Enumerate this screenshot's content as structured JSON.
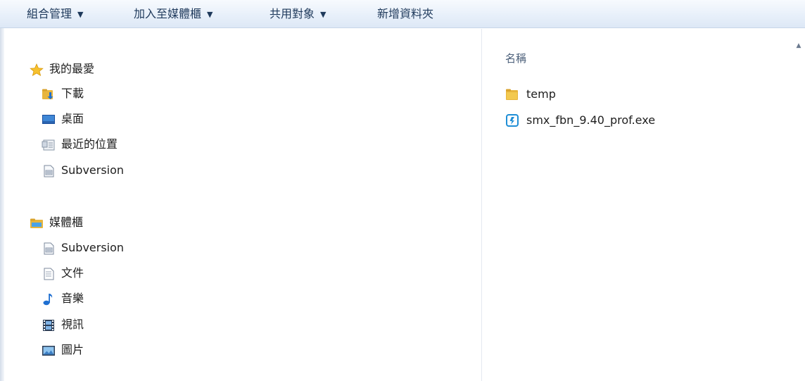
{
  "toolbar": {
    "organize": "組合管理",
    "add_to_library": "加入至媒體櫃",
    "share_with": "共用對象",
    "new_folder": "新增資料夾",
    "caret": "▼"
  },
  "nav": {
    "favorites": {
      "label": "我的最愛",
      "icon": "star-icon",
      "items": [
        {
          "label": "下載",
          "icon": "downloads-folder-icon"
        },
        {
          "label": "桌面",
          "icon": "desktop-icon"
        },
        {
          "label": "最近的位置",
          "icon": "recent-places-icon"
        },
        {
          "label": "Subversion",
          "icon": "document-icon"
        }
      ]
    },
    "libraries": {
      "label": "媒體櫃",
      "icon": "library-icon",
      "items": [
        {
          "label": "Subversion",
          "icon": "document-icon"
        },
        {
          "label": "文件",
          "icon": "documents-icon"
        },
        {
          "label": "音樂",
          "icon": "music-note-icon"
        },
        {
          "label": "視訊",
          "icon": "video-film-icon"
        },
        {
          "label": "圖片",
          "icon": "pictures-icon"
        }
      ]
    }
  },
  "content": {
    "column_name": "名稱",
    "files": [
      {
        "name": "temp",
        "icon": "folder-icon"
      },
      {
        "name": "smx_fbn_9.40_prof.exe",
        "icon": "executable-icon"
      }
    ]
  },
  "colors": {
    "toolbar_text": "#1e395b",
    "toolbar_bg_top": "#f7fafe",
    "toolbar_bg_bottom": "#dde8f6",
    "folder_yellow": "#e8b53c",
    "accent_blue": "#1f8ed6"
  }
}
